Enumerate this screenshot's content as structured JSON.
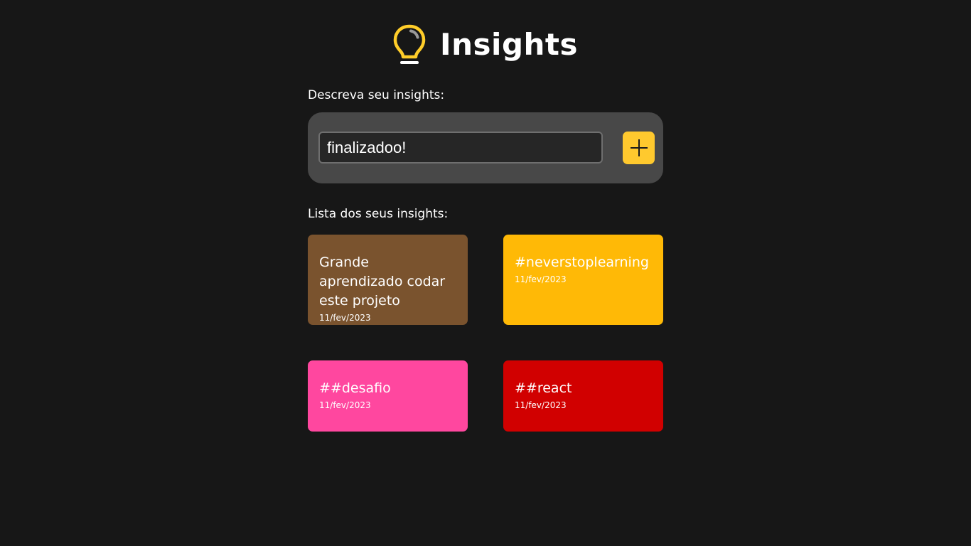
{
  "header": {
    "title": "Insights",
    "icon": "lightbulb-icon",
    "icon_color": "#ffcd29"
  },
  "form": {
    "label": "Descreva seu insights:",
    "input_value": "finalizadoo!",
    "add_button_icon": "plus-icon",
    "add_button_color": "#ffc92e"
  },
  "list": {
    "label": "Lista dos seus insights:",
    "items": [
      {
        "text": "Grande aprendizado codar este projeto",
        "date": "11/fev/2023",
        "color": "#7a532e"
      },
      {
        "text": "#neverstoplearning",
        "date": "11/fev/2023",
        "color": "#ffb906"
      },
      {
        "text": "##desafio",
        "date": "11/fev/2023",
        "color": "#ff479f"
      },
      {
        "text": "##react",
        "date": "11/fev/2023",
        "color": "#d10000"
      }
    ]
  }
}
